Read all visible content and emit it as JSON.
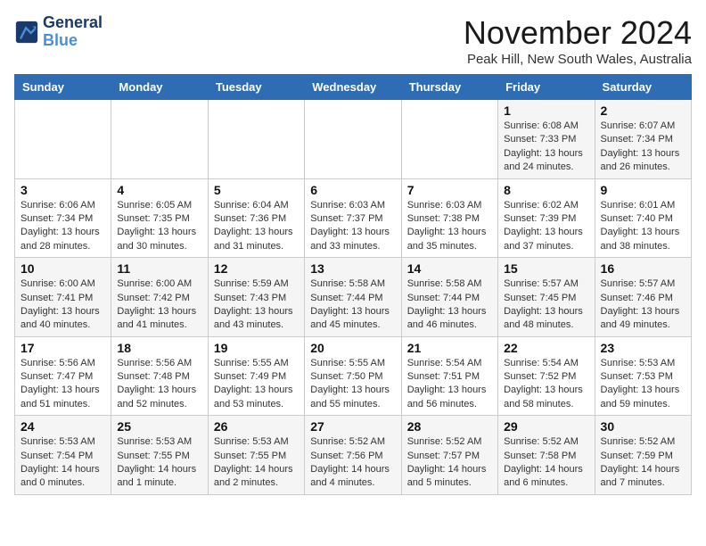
{
  "header": {
    "logo_line1": "General",
    "logo_line2": "Blue",
    "month": "November 2024",
    "location": "Peak Hill, New South Wales, Australia"
  },
  "days_of_week": [
    "Sunday",
    "Monday",
    "Tuesday",
    "Wednesday",
    "Thursday",
    "Friday",
    "Saturday"
  ],
  "weeks": [
    {
      "days": [
        {
          "num": "",
          "info": ""
        },
        {
          "num": "",
          "info": ""
        },
        {
          "num": "",
          "info": ""
        },
        {
          "num": "",
          "info": ""
        },
        {
          "num": "",
          "info": ""
        },
        {
          "num": "1",
          "info": "Sunrise: 6:08 AM\nSunset: 7:33 PM\nDaylight: 13 hours\nand 24 minutes."
        },
        {
          "num": "2",
          "info": "Sunrise: 6:07 AM\nSunset: 7:34 PM\nDaylight: 13 hours\nand 26 minutes."
        }
      ]
    },
    {
      "days": [
        {
          "num": "3",
          "info": "Sunrise: 6:06 AM\nSunset: 7:34 PM\nDaylight: 13 hours\nand 28 minutes."
        },
        {
          "num": "4",
          "info": "Sunrise: 6:05 AM\nSunset: 7:35 PM\nDaylight: 13 hours\nand 30 minutes."
        },
        {
          "num": "5",
          "info": "Sunrise: 6:04 AM\nSunset: 7:36 PM\nDaylight: 13 hours\nand 31 minutes."
        },
        {
          "num": "6",
          "info": "Sunrise: 6:03 AM\nSunset: 7:37 PM\nDaylight: 13 hours\nand 33 minutes."
        },
        {
          "num": "7",
          "info": "Sunrise: 6:03 AM\nSunset: 7:38 PM\nDaylight: 13 hours\nand 35 minutes."
        },
        {
          "num": "8",
          "info": "Sunrise: 6:02 AM\nSunset: 7:39 PM\nDaylight: 13 hours\nand 37 minutes."
        },
        {
          "num": "9",
          "info": "Sunrise: 6:01 AM\nSunset: 7:40 PM\nDaylight: 13 hours\nand 38 minutes."
        }
      ]
    },
    {
      "days": [
        {
          "num": "10",
          "info": "Sunrise: 6:00 AM\nSunset: 7:41 PM\nDaylight: 13 hours\nand 40 minutes."
        },
        {
          "num": "11",
          "info": "Sunrise: 6:00 AM\nSunset: 7:42 PM\nDaylight: 13 hours\nand 41 minutes."
        },
        {
          "num": "12",
          "info": "Sunrise: 5:59 AM\nSunset: 7:43 PM\nDaylight: 13 hours\nand 43 minutes."
        },
        {
          "num": "13",
          "info": "Sunrise: 5:58 AM\nSunset: 7:44 PM\nDaylight: 13 hours\nand 45 minutes."
        },
        {
          "num": "14",
          "info": "Sunrise: 5:58 AM\nSunset: 7:44 PM\nDaylight: 13 hours\nand 46 minutes."
        },
        {
          "num": "15",
          "info": "Sunrise: 5:57 AM\nSunset: 7:45 PM\nDaylight: 13 hours\nand 48 minutes."
        },
        {
          "num": "16",
          "info": "Sunrise: 5:57 AM\nSunset: 7:46 PM\nDaylight: 13 hours\nand 49 minutes."
        }
      ]
    },
    {
      "days": [
        {
          "num": "17",
          "info": "Sunrise: 5:56 AM\nSunset: 7:47 PM\nDaylight: 13 hours\nand 51 minutes."
        },
        {
          "num": "18",
          "info": "Sunrise: 5:56 AM\nSunset: 7:48 PM\nDaylight: 13 hours\nand 52 minutes."
        },
        {
          "num": "19",
          "info": "Sunrise: 5:55 AM\nSunset: 7:49 PM\nDaylight: 13 hours\nand 53 minutes."
        },
        {
          "num": "20",
          "info": "Sunrise: 5:55 AM\nSunset: 7:50 PM\nDaylight: 13 hours\nand 55 minutes."
        },
        {
          "num": "21",
          "info": "Sunrise: 5:54 AM\nSunset: 7:51 PM\nDaylight: 13 hours\nand 56 minutes."
        },
        {
          "num": "22",
          "info": "Sunrise: 5:54 AM\nSunset: 7:52 PM\nDaylight: 13 hours\nand 58 minutes."
        },
        {
          "num": "23",
          "info": "Sunrise: 5:53 AM\nSunset: 7:53 PM\nDaylight: 13 hours\nand 59 minutes."
        }
      ]
    },
    {
      "days": [
        {
          "num": "24",
          "info": "Sunrise: 5:53 AM\nSunset: 7:54 PM\nDaylight: 14 hours\nand 0 minutes."
        },
        {
          "num": "25",
          "info": "Sunrise: 5:53 AM\nSunset: 7:55 PM\nDaylight: 14 hours\nand 1 minute."
        },
        {
          "num": "26",
          "info": "Sunrise: 5:53 AM\nSunset: 7:55 PM\nDaylight: 14 hours\nand 2 minutes."
        },
        {
          "num": "27",
          "info": "Sunrise: 5:52 AM\nSunset: 7:56 PM\nDaylight: 14 hours\nand 4 minutes."
        },
        {
          "num": "28",
          "info": "Sunrise: 5:52 AM\nSunset: 7:57 PM\nDaylight: 14 hours\nand 5 minutes."
        },
        {
          "num": "29",
          "info": "Sunrise: 5:52 AM\nSunset: 7:58 PM\nDaylight: 14 hours\nand 6 minutes."
        },
        {
          "num": "30",
          "info": "Sunrise: 5:52 AM\nSunset: 7:59 PM\nDaylight: 14 hours\nand 7 minutes."
        }
      ]
    }
  ]
}
